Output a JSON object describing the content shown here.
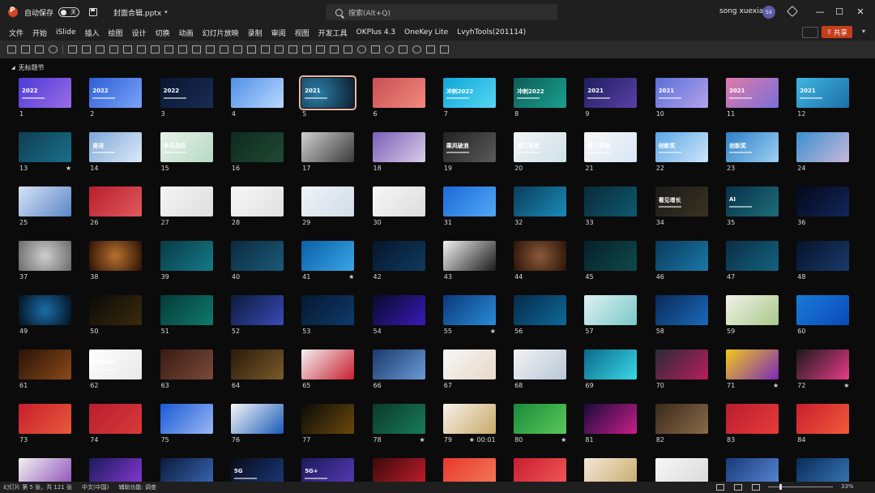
{
  "titlebar": {
    "autosave_label": "自动保存",
    "autosave_state": "关",
    "doc_title": "封面合辑.pptx",
    "search_placeholder": "搜索(Alt+Q)",
    "user_name": "song xuexian",
    "avatar_initials": "SX",
    "minimize": "—",
    "maximize": "☐",
    "close": "✕"
  },
  "menu": [
    "文件",
    "开始",
    "iSlide",
    "插入",
    "绘图",
    "设计",
    "切换",
    "动画",
    "幻灯片放映",
    "录制",
    "审阅",
    "视图",
    "开发工具",
    "OKPlus 4.3",
    "OneKey Lite",
    "LvyhTools(201114)"
  ],
  "share_label": "共享",
  "section_title": "无标题节",
  "colors": {
    "accent_share": "#c43e1c",
    "selected_outline": "#e8b8a8",
    "background": "#0b0b0b"
  },
  "slides": [
    {
      "n": "1",
      "bg": "linear-gradient(135deg,#4b3bd6,#9c6ce6)",
      "title": "2022",
      "mark": ""
    },
    {
      "n": "2",
      "bg": "linear-gradient(135deg,#2e5fd8,#7aa3f7)",
      "title": "2022",
      "mark": ""
    },
    {
      "n": "3",
      "bg": "linear-gradient(135deg,#0a1630,#1a2c55)",
      "title": "2022",
      "mark": ""
    },
    {
      "n": "4",
      "bg": "linear-gradient(135deg,#4f8fe6,#b9d8ff)",
      "title": "",
      "mark": ""
    },
    {
      "n": "5",
      "bg": "radial-gradient(circle at 30% 50%,#2b7fa8,#0d1f30)",
      "title": "2021",
      "mark": "",
      "selected": true
    },
    {
      "n": "6",
      "bg": "linear-gradient(135deg,#c94e54,#f18a7d)",
      "title": "",
      "mark": ""
    },
    {
      "n": "7",
      "bg": "linear-gradient(135deg,#0fa6d8,#55d6f2)",
      "title": "冲刺2022",
      "mark": ""
    },
    {
      "n": "8",
      "bg": "linear-gradient(135deg,#0c5d58,#19a08f)",
      "title": "冲刺2022",
      "mark": ""
    },
    {
      "n": "9",
      "bg": "linear-gradient(135deg,#1e1f5c,#5a3fa8)",
      "title": "2021",
      "mark": ""
    },
    {
      "n": "10",
      "bg": "linear-gradient(135deg,#5a6fd6,#b3a3ec)",
      "title": "2021",
      "mark": ""
    },
    {
      "n": "11",
      "bg": "linear-gradient(135deg,#e07aa8,#7b6fd8)",
      "title": "2021",
      "mark": ""
    },
    {
      "n": "12",
      "bg": "linear-gradient(135deg,#3fb6e0,#1e6fa8)",
      "title": "2021",
      "mark": ""
    },
    {
      "n": "13",
      "bg": "linear-gradient(135deg,#0f3e52,#1a6e8a)",
      "title": "",
      "mark": "★"
    },
    {
      "n": "14",
      "bg": "linear-gradient(135deg,#7ea8d8,#dce9f7)",
      "title": "奋进",
      "mark": ""
    },
    {
      "n": "15",
      "bg": "linear-gradient(135deg,#e8f1ea,#b6d9c4)",
      "title": "争先恐后",
      "mark": ""
    },
    {
      "n": "16",
      "bg": "linear-gradient(135deg,#0e2a1e,#1f4a34)",
      "title": "",
      "mark": ""
    },
    {
      "n": "17",
      "bg": "linear-gradient(135deg,#d0d0d0,#3a3a3a)",
      "title": "",
      "mark": ""
    },
    {
      "n": "18",
      "bg": "linear-gradient(135deg,#7a5fb8,#d8cde8)",
      "title": "",
      "mark": ""
    },
    {
      "n": "19",
      "bg": "linear-gradient(135deg,#222,#5a5a5a)",
      "title": "乘风破浪",
      "mark": ""
    },
    {
      "n": "20",
      "bg": "linear-gradient(135deg,#f2f5f7,#cfe0e8)",
      "title": "第三季度",
      "mark": ""
    },
    {
      "n": "21",
      "bg": "linear-gradient(135deg,#f7f7f7,#d8e6f5)",
      "title": "第三季度",
      "mark": ""
    },
    {
      "n": "22",
      "bg": "linear-gradient(135deg,#5aa6e6,#cfe6fa)",
      "title": "创新奖",
      "mark": ""
    },
    {
      "n": "23",
      "bg": "linear-gradient(135deg,#2d7fc6,#9fd0f2)",
      "title": "创新奖",
      "mark": ""
    },
    {
      "n": "24",
      "bg": "linear-gradient(135deg,#3a8fd0,#c8b8d8)",
      "title": "",
      "mark": ""
    },
    {
      "n": "25",
      "bg": "linear-gradient(135deg,#d8e4f5,#5a86c8)",
      "title": "",
      "mark": ""
    },
    {
      "n": "26",
      "bg": "linear-gradient(135deg,#b81e2e,#e05a5a)",
      "title": "",
      "mark": ""
    },
    {
      "n": "27",
      "bg": "linear-gradient(135deg,#f5f5f5,#dedede)",
      "title": "",
      "mark": ""
    },
    {
      "n": "28",
      "bg": "linear-gradient(135deg,#f7f7f7,#e0e0e0)",
      "title": "",
      "mark": ""
    },
    {
      "n": "29",
      "bg": "linear-gradient(135deg,#f0f4f7,#cfdce8)",
      "title": "",
      "mark": ""
    },
    {
      "n": "30",
      "bg": "linear-gradient(135deg,#f7f7f7,#dcdcdc)",
      "title": "",
      "mark": ""
    },
    {
      "n": "31",
      "bg": "linear-gradient(135deg,#1c6ad8,#52a8f5)",
      "title": "",
      "mark": ""
    },
    {
      "n": "32",
      "bg": "linear-gradient(135deg,#0a3e5a,#1b8ab8)",
      "title": "",
      "mark": ""
    },
    {
      "n": "33",
      "bg": "linear-gradient(135deg,#082a3a,#0f5a6e)",
      "title": "",
      "mark": ""
    },
    {
      "n": "34",
      "bg": "linear-gradient(135deg,#1a1a1a,#3a3320)",
      "title": "看见增长",
      "mark": ""
    },
    {
      "n": "35",
      "bg": "linear-gradient(135deg,#083048,#1e6e7a)",
      "title": "AI",
      "mark": ""
    },
    {
      "n": "36",
      "bg": "linear-gradient(135deg,#04081a,#12265a)",
      "title": "",
      "mark": ""
    },
    {
      "n": "37",
      "bg": "radial-gradient(circle,#cfcfcf,#6a6a6a)",
      "title": "",
      "mark": ""
    },
    {
      "n": "38",
      "bg": "radial-gradient(circle,#b8722e,#2a0f05)",
      "title": "",
      "mark": ""
    },
    {
      "n": "39",
      "bg": "linear-gradient(135deg,#0a3a44,#147a8a)",
      "title": "",
      "mark": ""
    },
    {
      "n": "40",
      "bg": "linear-gradient(135deg,#0c2a3e,#1a5a78)",
      "title": "",
      "mark": ""
    },
    {
      "n": "41",
      "bg": "linear-gradient(135deg,#0a5fa8,#3aa6e6)",
      "title": "",
      "mark": "★"
    },
    {
      "n": "42",
      "bg": "linear-gradient(135deg,#07152a,#0e3a5e)",
      "title": "",
      "mark": ""
    },
    {
      "n": "43",
      "bg": "linear-gradient(135deg,#f2f2f2,#1a1a1a)",
      "title": "",
      "mark": ""
    },
    {
      "n": "44",
      "bg": "radial-gradient(circle,#8a5a3a,#2a1206)",
      "title": "",
      "mark": ""
    },
    {
      "n": "45",
      "bg": "linear-gradient(135deg,#06202a,#0e4a4a)",
      "title": "",
      "mark": ""
    },
    {
      "n": "46",
      "bg": "linear-gradient(135deg,#0a3a5a,#1a78a8)",
      "title": "",
      "mark": ""
    },
    {
      "n": "47",
      "bg": "linear-gradient(135deg,#0a2e44,#14627e)",
      "title": "",
      "mark": ""
    },
    {
      "n": "48",
      "bg": "linear-gradient(135deg,#06122a,#1a3a6a)",
      "title": "",
      "mark": ""
    },
    {
      "n": "49",
      "bg": "radial-gradient(circle,#1a6ea8,#03101e)",
      "title": "",
      "mark": ""
    },
    {
      "n": "50",
      "bg": "linear-gradient(135deg,#0a0a0a,#3a2a0a)",
      "title": "",
      "mark": ""
    },
    {
      "n": "51",
      "bg": "linear-gradient(135deg,#063a3a,#0e7a6a)",
      "title": "",
      "mark": ""
    },
    {
      "n": "52",
      "bg": "linear-gradient(135deg,#0a1a3a,#3a4ab8)",
      "title": "",
      "mark": ""
    },
    {
      "n": "53",
      "bg": "linear-gradient(135deg,#071830,#0e3a6a)",
      "title": "",
      "mark": ""
    },
    {
      "n": "54",
      "bg": "linear-gradient(135deg,#080a2a,#3a1ab8)",
      "title": "",
      "mark": ""
    },
    {
      "n": "55",
      "bg": "linear-gradient(135deg,#0a3a78,#2a8ad8)",
      "title": "",
      "mark": "★"
    },
    {
      "n": "56",
      "bg": "linear-gradient(135deg,#062a4a,#0e6a9a)",
      "title": "",
      "mark": ""
    },
    {
      "n": "57",
      "bg": "linear-gradient(135deg,#dff2f2,#7ac8c8)",
      "title": "",
      "mark": ""
    },
    {
      "n": "58",
      "bg": "linear-gradient(135deg,#0a2a5a,#1a6ab8)",
      "title": "",
      "mark": ""
    },
    {
      "n": "59",
      "bg": "linear-gradient(135deg,#f2f2e8,#a8c88a)",
      "title": "",
      "mark": ""
    },
    {
      "n": "60",
      "bg": "linear-gradient(135deg,#1a7ad8,#0a4ab8)",
      "title": "",
      "mark": ""
    },
    {
      "n": "61",
      "bg": "linear-gradient(135deg,#2a1206,#8a4a1a)",
      "title": "",
      "mark": ""
    },
    {
      "n": "62",
      "bg": "linear-gradient(135deg,#ffffff,#e8e8e8)",
      "title": "HUBAO",
      "mark": ""
    },
    {
      "n": "63",
      "bg": "linear-gradient(135deg,#3a1a12,#7a4a3a)",
      "title": "",
      "mark": ""
    },
    {
      "n": "64",
      "bg": "linear-gradient(135deg,#2a1a0a,#7a5a2a)",
      "title": "",
      "mark": ""
    },
    {
      "n": "65",
      "bg": "linear-gradient(135deg,#f2f2f2,#c81e2e)",
      "title": "",
      "mark": ""
    },
    {
      "n": "66",
      "bg": "linear-gradient(135deg,#1a3a6a,#6a9ad8)",
      "title": "",
      "mark": ""
    },
    {
      "n": "67",
      "bg": "linear-gradient(135deg,#f7f7f7,#e8d8c8)",
      "title": "",
      "mark": ""
    },
    {
      "n": "68",
      "bg": "linear-gradient(135deg,#f2f2f2,#b8c8d8)",
      "title": "",
      "mark": ""
    },
    {
      "n": "69",
      "bg": "linear-gradient(135deg,#0a6a8a,#3ad8e8)",
      "title": "",
      "mark": ""
    },
    {
      "n": "70",
      "bg": "linear-gradient(135deg,#2a2a3a,#b81e5a)",
      "title": "",
      "mark": ""
    },
    {
      "n": "71",
      "bg": "linear-gradient(135deg,#f2c81e,#7a2ab8)",
      "title": "",
      "mark": "★"
    },
    {
      "n": "72",
      "bg": "linear-gradient(135deg,#1a1a1a,#e83a8a)",
      "title": "",
      "mark": "★"
    },
    {
      "n": "73",
      "bg": "linear-gradient(135deg,#c81e2e,#e85a3a)",
      "title": "",
      "mark": ""
    },
    {
      "n": "74",
      "bg": "linear-gradient(135deg,#b81e2e,#d83a3a)",
      "title": "",
      "mark": ""
    },
    {
      "n": "75",
      "bg": "linear-gradient(135deg,#1a5ad8,#9ab8f2)",
      "title": "",
      "mark": ""
    },
    {
      "n": "76",
      "bg": "linear-gradient(135deg,#f7f7f7,#1a5ab8)",
      "title": "",
      "mark": ""
    },
    {
      "n": "77",
      "bg": "linear-gradient(135deg,#0a0a0a,#6a4a0a)",
      "title": "",
      "mark": ""
    },
    {
      "n": "78",
      "bg": "linear-gradient(135deg,#0a3a2a,#1a7a5a)",
      "title": "",
      "mark": "★"
    },
    {
      "n": "79",
      "bg": "linear-gradient(135deg,#f7f2e8,#c8a86a)",
      "title": "",
      "mark": "★ 00:01"
    },
    {
      "n": "80",
      "bg": "linear-gradient(135deg,#1a8a3a,#5ac85a)",
      "title": "",
      "mark": "★"
    },
    {
      "n": "81",
      "bg": "linear-gradient(135deg,#1a0a3a,#c81e8a)",
      "title": "",
      "mark": ""
    },
    {
      "n": "82",
      "bg": "linear-gradient(135deg,#3a2a1a,#8a6a4a)",
      "title": "",
      "mark": ""
    },
    {
      "n": "83",
      "bg": "linear-gradient(135deg,#b81e2e,#e83a3a)",
      "title": "",
      "mark": ""
    },
    {
      "n": "84",
      "bg": "linear-gradient(135deg,#c81e2e,#f25a3a)",
      "title": "",
      "mark": ""
    },
    {
      "n": "",
      "bg": "linear-gradient(135deg,#f2f2f2,#8a4ab8)",
      "title": "",
      "mark": ""
    },
    {
      "n": "",
      "bg": "linear-gradient(135deg,#1a1a5a,#8a3ad8)",
      "title": "",
      "mark": ""
    },
    {
      "n": "",
      "bg": "linear-gradient(135deg,#0a1a3a,#3a6ab8)",
      "title": "",
      "mark": ""
    },
    {
      "n": "",
      "bg": "linear-gradient(135deg,#0a0a1a,#1a3a7a)",
      "title": "5G",
      "mark": ""
    },
    {
      "n": "",
      "bg": "linear-gradient(135deg,#1a1a5a,#5a3ab8)",
      "title": "5G+",
      "mark": ""
    },
    {
      "n": "",
      "bg": "linear-gradient(135deg,#3a0a0a,#c81e2e)",
      "title": "",
      "mark": ""
    },
    {
      "n": "",
      "bg": "linear-gradient(135deg,#e83a2e,#f27a5a)",
      "title": "",
      "mark": ""
    },
    {
      "n": "",
      "bg": "linear-gradient(135deg,#c81e2e,#f25a5a)",
      "title": "",
      "mark": ""
    },
    {
      "n": "",
      "bg": "linear-gradient(135deg,#f2e8d8,#c8a86a)",
      "title": "",
      "mark": ""
    },
    {
      "n": "",
      "bg": "linear-gradient(135deg,#f7f7f7,#d8d8d8)",
      "title": "",
      "mark": ""
    },
    {
      "n": "",
      "bg": "linear-gradient(135deg,#1a3a7a,#5a8ad8)",
      "title": "",
      "mark": ""
    },
    {
      "n": "",
      "bg": "linear-gradient(135deg,#0a2a5a,#3a7ab8)",
      "title": "",
      "mark": ""
    }
  ],
  "statusbar": {
    "slide_info": "幻灯片 第 5 张，共 121 张",
    "language": "中文(中国)",
    "accessibility": "辅助功能: 调查",
    "zoom": "33%"
  }
}
